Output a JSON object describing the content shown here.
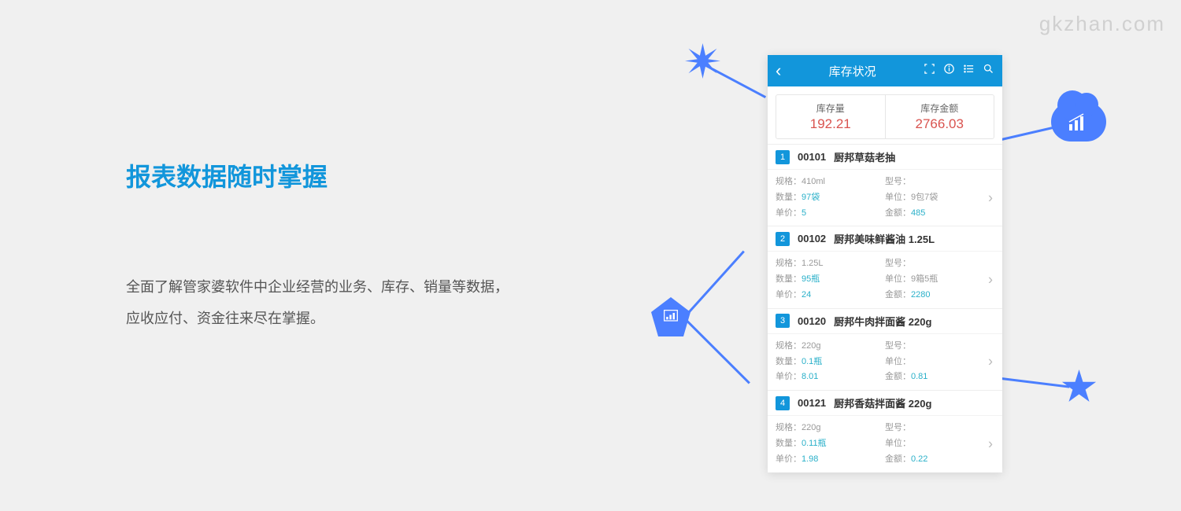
{
  "watermark": "gkzhan.com",
  "heading": "报表数据随时掌握",
  "description": "全面了解管家婆软件中企业经营的业务、库存、销量等数据，应收应付、资金往来尽在掌握。",
  "phone": {
    "title": "库存状况",
    "summary": {
      "qty_label": "库存量",
      "qty_value": "192.21",
      "amount_label": "库存金额",
      "amount_value": "2766.03"
    },
    "labels": {
      "spec": "规格：",
      "model": "型号：",
      "qty": "数量：",
      "unit": "单位：",
      "price": "单价：",
      "amount": "金额："
    },
    "items": [
      {
        "num": "1",
        "code": "00101",
        "name": "厨邦草菇老抽",
        "spec": "410ml",
        "model": "",
        "qty": "97袋",
        "unit": "9包7袋",
        "price": "5",
        "amount": "485"
      },
      {
        "num": "2",
        "code": "00102",
        "name": "厨邦美味鲜酱油 1.25L",
        "spec": "1.25L",
        "model": "",
        "qty": "95瓶",
        "unit": "9箱5瓶",
        "price": "24",
        "amount": "2280"
      },
      {
        "num": "3",
        "code": "00120",
        "name": "厨邦牛肉拌面酱 220g",
        "spec": "220g",
        "model": "",
        "qty": "0.1瓶",
        "unit": "",
        "price": "8.01",
        "amount": "0.81"
      },
      {
        "num": "4",
        "code": "00121",
        "name": "厨邦香菇拌面酱 220g",
        "spec": "220g",
        "model": "",
        "qty": "0.11瓶",
        "unit": "",
        "price": "1.98",
        "amount": "0.22"
      }
    ]
  }
}
